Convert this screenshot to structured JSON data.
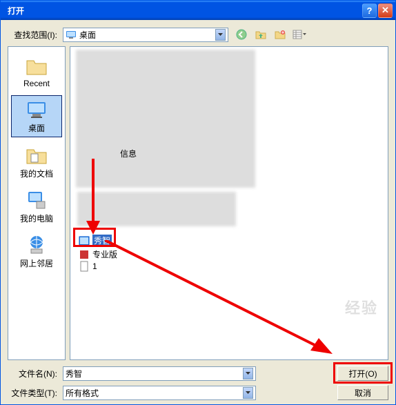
{
  "title": "打开",
  "lookin": {
    "label": "查找范围(I):",
    "value": "桌面"
  },
  "places": [
    {
      "id": "recent",
      "label": "Recent"
    },
    {
      "id": "desktop",
      "label": "桌面",
      "selected": true
    },
    {
      "id": "mydocs",
      "label": "我的文档"
    },
    {
      "id": "mycomputer",
      "label": "我的电脑"
    },
    {
      "id": "network",
      "label": "网上邻居"
    }
  ],
  "files": {
    "info_label": "信息",
    "selected_file": "秀智",
    "item_pro": "专业版",
    "item_1": "1"
  },
  "filename": {
    "label": "文件名(N):",
    "value": "秀智"
  },
  "filetype": {
    "label": "文件类型(T):",
    "value": "所有格式"
  },
  "buttons": {
    "open": "打开(O)",
    "cancel": "取消"
  }
}
